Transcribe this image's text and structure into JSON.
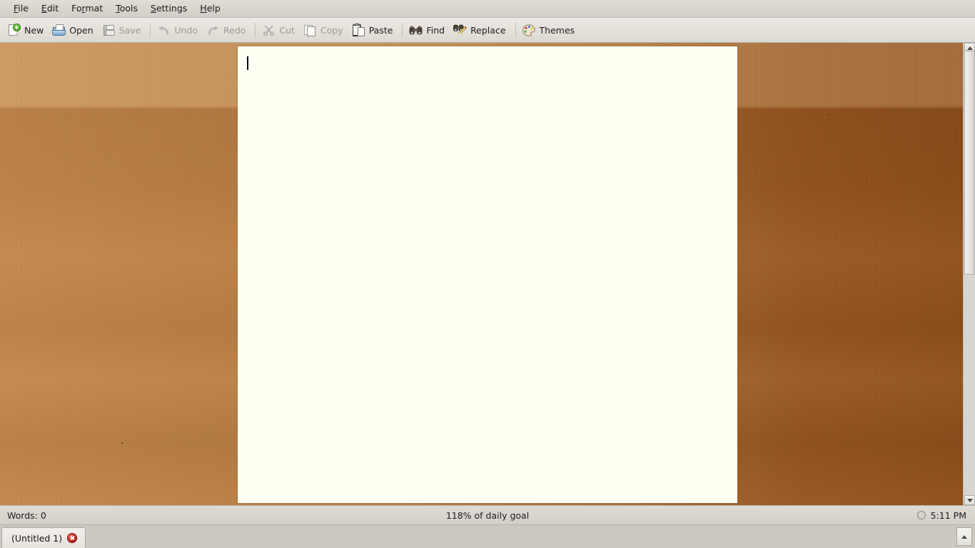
{
  "menubar": {
    "items": [
      {
        "label": "File",
        "mnemonic": "F"
      },
      {
        "label": "Edit",
        "mnemonic": "E"
      },
      {
        "label": "Format",
        "mnemonic": "r"
      },
      {
        "label": "Tools",
        "mnemonic": "T"
      },
      {
        "label": "Settings",
        "mnemonic": "S"
      },
      {
        "label": "Help",
        "mnemonic": "H"
      }
    ]
  },
  "toolbar": {
    "new_label": "New",
    "open_label": "Open",
    "save_label": "Save",
    "undo_label": "Undo",
    "redo_label": "Redo",
    "cut_label": "Cut",
    "copy_label": "Copy",
    "paste_label": "Paste",
    "find_label": "Find",
    "replace_label": "Replace",
    "themes_label": "Themes",
    "icons": {
      "new": "new-document-icon",
      "open": "open-folder-icon",
      "save": "floppy-disk-icon",
      "undo": "undo-arrow-icon",
      "redo": "redo-arrow-icon",
      "cut": "scissors-icon",
      "copy": "copy-pages-icon",
      "paste": "clipboard-icon",
      "find": "binoculars-icon",
      "replace": "binoculars-pencil-icon",
      "themes": "paint-palette-icon"
    }
  },
  "editor": {
    "content": "",
    "placeholder": ""
  },
  "statusbar": {
    "words": "Words: 0",
    "goal": "118% of daily goal",
    "time": "5:11 PM",
    "timer_icon": "timer-circle-icon"
  },
  "tabs": [
    {
      "label": "(Untitled 1)",
      "close_icon": "close-circle-icon",
      "active": true
    }
  ],
  "scrollbar": {
    "up_icon": "triangle-up-icon",
    "down_icon": "triangle-down-icon"
  },
  "tab_scroll": {
    "icon": "triangle-up-icon"
  },
  "colors": {
    "page_background": "#fffff4",
    "chrome": "#d8d5ce",
    "desktop_wood_light": "#c3874a",
    "desktop_wood_dark": "#8d4d19",
    "close_red": "#b81c12",
    "new_green": "#3c9c1e",
    "folder_blue": "#5d8cb6"
  }
}
